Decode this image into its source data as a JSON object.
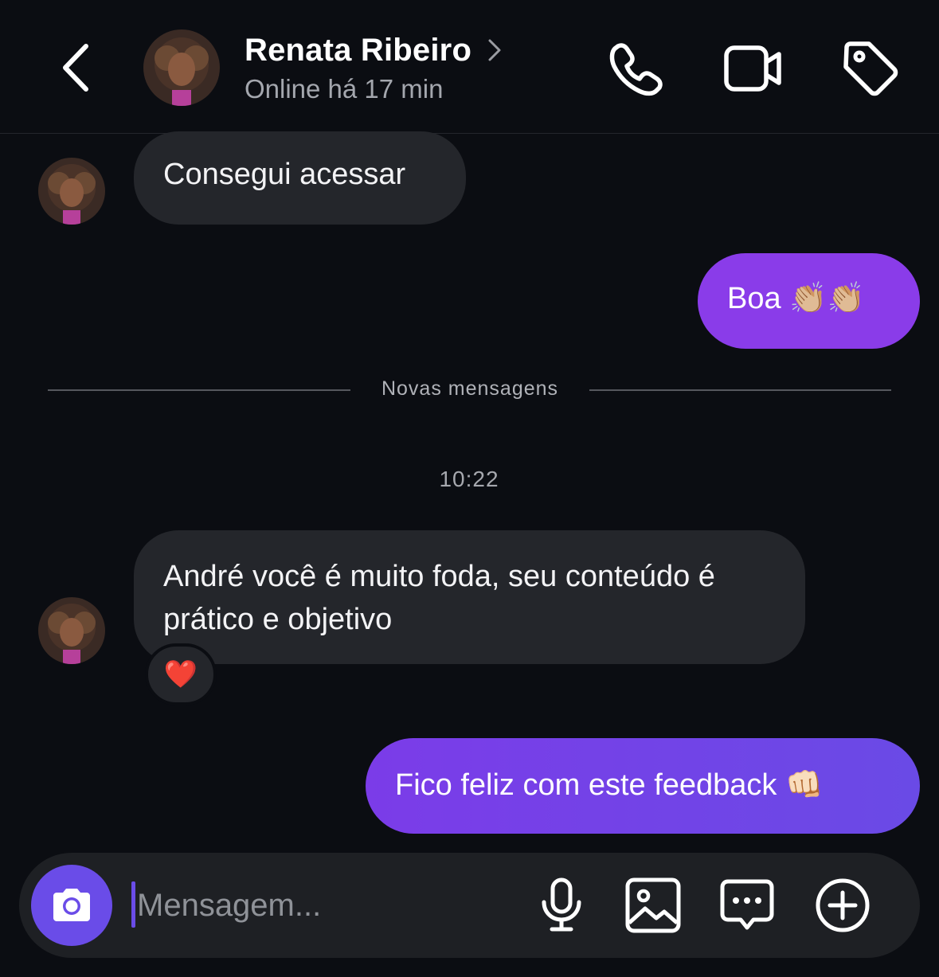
{
  "header": {
    "name": "Renata Ribeiro",
    "status": "Online há 17 min"
  },
  "messages": [
    {
      "id": "m1",
      "direction": "incoming",
      "text": "Consegui acessar"
    },
    {
      "id": "m2",
      "direction": "outgoing",
      "text": "Boa 👏🏼👏🏼"
    },
    {
      "id": "m3",
      "direction": "incoming",
      "text": "André você é muito foda, seu conteúdo é prático e objetivo",
      "reaction": "❤️"
    },
    {
      "id": "m4",
      "direction": "outgoing",
      "text": "Fico feliz com este feedback 👊🏻"
    }
  ],
  "divider": {
    "label": "Novas mensagens"
  },
  "timestamp": "10:22",
  "composer": {
    "placeholder": "Mensagem...",
    "value": ""
  },
  "colors": {
    "background": "#0b0d12",
    "incoming_bubble": "#24262b",
    "outgoing_bubble": "#7b3ce8",
    "accent": "#6a4ce8"
  },
  "icons": {
    "back": "chevron-left-icon",
    "call": "phone-icon",
    "video": "video-camera-icon",
    "tag": "tag-icon",
    "camera": "camera-icon",
    "mic": "microphone-icon",
    "gallery": "image-icon",
    "chat": "chat-bubble-icon",
    "add": "plus-circle-icon"
  }
}
